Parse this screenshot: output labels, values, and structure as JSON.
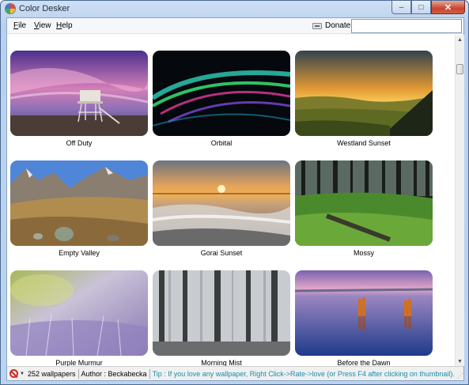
{
  "window": {
    "title": "Color Desker",
    "minimize": "‒",
    "maximize": "□",
    "close": "✕"
  },
  "menu": {
    "file_rest": "ile",
    "file_key": "F",
    "view_rest": "iew",
    "view_key": "V",
    "help_rest": "elp",
    "help_key": "H",
    "donate": "Donate"
  },
  "search": {
    "value": "",
    "placeholder": ""
  },
  "wallpapers": [
    {
      "caption": "Off Duty",
      "icon": "lifeguard-tower-sunset"
    },
    {
      "caption": "Orbital",
      "icon": "abstract-waves"
    },
    {
      "caption": "Westland Sunset",
      "icon": "hills-sunset"
    },
    {
      "caption": "Empty Valley",
      "icon": "mountain-valley"
    },
    {
      "caption": "Gorai Sunset",
      "icon": "ocean-sunset"
    },
    {
      "caption": "Mossy",
      "icon": "mossy-forest"
    },
    {
      "caption": "Purple Murmur",
      "icon": "blurred-grass"
    },
    {
      "caption": "Morning Mist",
      "icon": "misty-forest"
    },
    {
      "caption": "Before the Dawn",
      "icon": "lake-posts"
    }
  ],
  "status": {
    "count": "252 wallpapers",
    "author": "Author : Beckabecka",
    "tip": "Tip : If you love any wallpaper, Right Click->Rate->love (or Press F4 after clicking on thumbnail)."
  },
  "colors": {
    "tip_text": "#1a8fa8",
    "close_button": "#c7452f"
  }
}
